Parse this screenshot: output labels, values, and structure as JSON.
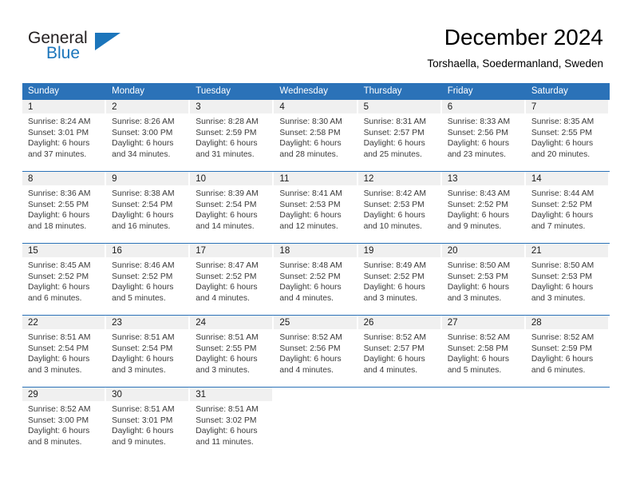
{
  "brand": {
    "name_part1": "General",
    "name_part2": "Blue",
    "flag_icon": "blue-triangle-flag",
    "accent_color": "#1b75bb"
  },
  "header": {
    "title": "December 2024",
    "subtitle": "Torshaella, Soedermanland, Sweden"
  },
  "calendar": {
    "header_background": "#2b72b8",
    "daynumber_background": "#f0f0f0",
    "weekday_headers": [
      "Sunday",
      "Monday",
      "Tuesday",
      "Wednesday",
      "Thursday",
      "Friday",
      "Saturday"
    ],
    "weeks": [
      [
        {
          "day": "1",
          "sunrise": "Sunrise: 8:24 AM",
          "sunset": "Sunset: 3:01 PM",
          "daylight_line1": "Daylight: 6 hours",
          "daylight_line2": "and 37 minutes."
        },
        {
          "day": "2",
          "sunrise": "Sunrise: 8:26 AM",
          "sunset": "Sunset: 3:00 PM",
          "daylight_line1": "Daylight: 6 hours",
          "daylight_line2": "and 34 minutes."
        },
        {
          "day": "3",
          "sunrise": "Sunrise: 8:28 AM",
          "sunset": "Sunset: 2:59 PM",
          "daylight_line1": "Daylight: 6 hours",
          "daylight_line2": "and 31 minutes."
        },
        {
          "day": "4",
          "sunrise": "Sunrise: 8:30 AM",
          "sunset": "Sunset: 2:58 PM",
          "daylight_line1": "Daylight: 6 hours",
          "daylight_line2": "and 28 minutes."
        },
        {
          "day": "5",
          "sunrise": "Sunrise: 8:31 AM",
          "sunset": "Sunset: 2:57 PM",
          "daylight_line1": "Daylight: 6 hours",
          "daylight_line2": "and 25 minutes."
        },
        {
          "day": "6",
          "sunrise": "Sunrise: 8:33 AM",
          "sunset": "Sunset: 2:56 PM",
          "daylight_line1": "Daylight: 6 hours",
          "daylight_line2": "and 23 minutes."
        },
        {
          "day": "7",
          "sunrise": "Sunrise: 8:35 AM",
          "sunset": "Sunset: 2:55 PM",
          "daylight_line1": "Daylight: 6 hours",
          "daylight_line2": "and 20 minutes."
        }
      ],
      [
        {
          "day": "8",
          "sunrise": "Sunrise: 8:36 AM",
          "sunset": "Sunset: 2:55 PM",
          "daylight_line1": "Daylight: 6 hours",
          "daylight_line2": "and 18 minutes."
        },
        {
          "day": "9",
          "sunrise": "Sunrise: 8:38 AM",
          "sunset": "Sunset: 2:54 PM",
          "daylight_line1": "Daylight: 6 hours",
          "daylight_line2": "and 16 minutes."
        },
        {
          "day": "10",
          "sunrise": "Sunrise: 8:39 AM",
          "sunset": "Sunset: 2:54 PM",
          "daylight_line1": "Daylight: 6 hours",
          "daylight_line2": "and 14 minutes."
        },
        {
          "day": "11",
          "sunrise": "Sunrise: 8:41 AM",
          "sunset": "Sunset: 2:53 PM",
          "daylight_line1": "Daylight: 6 hours",
          "daylight_line2": "and 12 minutes."
        },
        {
          "day": "12",
          "sunrise": "Sunrise: 8:42 AM",
          "sunset": "Sunset: 2:53 PM",
          "daylight_line1": "Daylight: 6 hours",
          "daylight_line2": "and 10 minutes."
        },
        {
          "day": "13",
          "sunrise": "Sunrise: 8:43 AM",
          "sunset": "Sunset: 2:52 PM",
          "daylight_line1": "Daylight: 6 hours",
          "daylight_line2": "and 9 minutes."
        },
        {
          "day": "14",
          "sunrise": "Sunrise: 8:44 AM",
          "sunset": "Sunset: 2:52 PM",
          "daylight_line1": "Daylight: 6 hours",
          "daylight_line2": "and 7 minutes."
        }
      ],
      [
        {
          "day": "15",
          "sunrise": "Sunrise: 8:45 AM",
          "sunset": "Sunset: 2:52 PM",
          "daylight_line1": "Daylight: 6 hours",
          "daylight_line2": "and 6 minutes."
        },
        {
          "day": "16",
          "sunrise": "Sunrise: 8:46 AM",
          "sunset": "Sunset: 2:52 PM",
          "daylight_line1": "Daylight: 6 hours",
          "daylight_line2": "and 5 minutes."
        },
        {
          "day": "17",
          "sunrise": "Sunrise: 8:47 AM",
          "sunset": "Sunset: 2:52 PM",
          "daylight_line1": "Daylight: 6 hours",
          "daylight_line2": "and 4 minutes."
        },
        {
          "day": "18",
          "sunrise": "Sunrise: 8:48 AM",
          "sunset": "Sunset: 2:52 PM",
          "daylight_line1": "Daylight: 6 hours",
          "daylight_line2": "and 4 minutes."
        },
        {
          "day": "19",
          "sunrise": "Sunrise: 8:49 AM",
          "sunset": "Sunset: 2:52 PM",
          "daylight_line1": "Daylight: 6 hours",
          "daylight_line2": "and 3 minutes."
        },
        {
          "day": "20",
          "sunrise": "Sunrise: 8:50 AM",
          "sunset": "Sunset: 2:53 PM",
          "daylight_line1": "Daylight: 6 hours",
          "daylight_line2": "and 3 minutes."
        },
        {
          "day": "21",
          "sunrise": "Sunrise: 8:50 AM",
          "sunset": "Sunset: 2:53 PM",
          "daylight_line1": "Daylight: 6 hours",
          "daylight_line2": "and 3 minutes."
        }
      ],
      [
        {
          "day": "22",
          "sunrise": "Sunrise: 8:51 AM",
          "sunset": "Sunset: 2:54 PM",
          "daylight_line1": "Daylight: 6 hours",
          "daylight_line2": "and 3 minutes."
        },
        {
          "day": "23",
          "sunrise": "Sunrise: 8:51 AM",
          "sunset": "Sunset: 2:54 PM",
          "daylight_line1": "Daylight: 6 hours",
          "daylight_line2": "and 3 minutes."
        },
        {
          "day": "24",
          "sunrise": "Sunrise: 8:51 AM",
          "sunset": "Sunset: 2:55 PM",
          "daylight_line1": "Daylight: 6 hours",
          "daylight_line2": "and 3 minutes."
        },
        {
          "day": "25",
          "sunrise": "Sunrise: 8:52 AM",
          "sunset": "Sunset: 2:56 PM",
          "daylight_line1": "Daylight: 6 hours",
          "daylight_line2": "and 4 minutes."
        },
        {
          "day": "26",
          "sunrise": "Sunrise: 8:52 AM",
          "sunset": "Sunset: 2:57 PM",
          "daylight_line1": "Daylight: 6 hours",
          "daylight_line2": "and 4 minutes."
        },
        {
          "day": "27",
          "sunrise": "Sunrise: 8:52 AM",
          "sunset": "Sunset: 2:58 PM",
          "daylight_line1": "Daylight: 6 hours",
          "daylight_line2": "and 5 minutes."
        },
        {
          "day": "28",
          "sunrise": "Sunrise: 8:52 AM",
          "sunset": "Sunset: 2:59 PM",
          "daylight_line1": "Daylight: 6 hours",
          "daylight_line2": "and 6 minutes."
        }
      ],
      [
        {
          "day": "29",
          "sunrise": "Sunrise: 8:52 AM",
          "sunset": "Sunset: 3:00 PM",
          "daylight_line1": "Daylight: 6 hours",
          "daylight_line2": "and 8 minutes."
        },
        {
          "day": "30",
          "sunrise": "Sunrise: 8:51 AM",
          "sunset": "Sunset: 3:01 PM",
          "daylight_line1": "Daylight: 6 hours",
          "daylight_line2": "and 9 minutes."
        },
        {
          "day": "31",
          "sunrise": "Sunrise: 8:51 AM",
          "sunset": "Sunset: 3:02 PM",
          "daylight_line1": "Daylight: 6 hours",
          "daylight_line2": "and 11 minutes."
        },
        {
          "day": "",
          "sunrise": "",
          "sunset": "",
          "daylight_line1": "",
          "daylight_line2": ""
        },
        {
          "day": "",
          "sunrise": "",
          "sunset": "",
          "daylight_line1": "",
          "daylight_line2": ""
        },
        {
          "day": "",
          "sunrise": "",
          "sunset": "",
          "daylight_line1": "",
          "daylight_line2": ""
        },
        {
          "day": "",
          "sunrise": "",
          "sunset": "",
          "daylight_line1": "",
          "daylight_line2": ""
        }
      ]
    ]
  }
}
